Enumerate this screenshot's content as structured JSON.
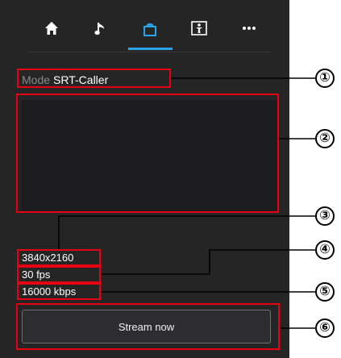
{
  "tabs": [
    {
      "name": "home",
      "icon": "home-icon",
      "active": false
    },
    {
      "name": "audio",
      "icon": "music-note-icon",
      "active": false
    },
    {
      "name": "stream",
      "icon": "stream-icon",
      "active": true
    },
    {
      "name": "display",
      "icon": "person-frame-icon",
      "active": false
    },
    {
      "name": "more",
      "icon": "more-icon",
      "active": false
    }
  ],
  "mode": {
    "label": "Mode",
    "value": "SRT-Caller"
  },
  "info": {
    "resolution": "3840x2160",
    "framerate": "30 fps",
    "bitrate": "16000 kbps"
  },
  "stream_button": {
    "label": "Stream now"
  },
  "callouts": [
    "①",
    "②",
    "③",
    "④",
    "⑤",
    "⑥"
  ],
  "colors": {
    "panel": "#252526",
    "accent": "#2aa3ea",
    "highlight": "#e60012"
  }
}
